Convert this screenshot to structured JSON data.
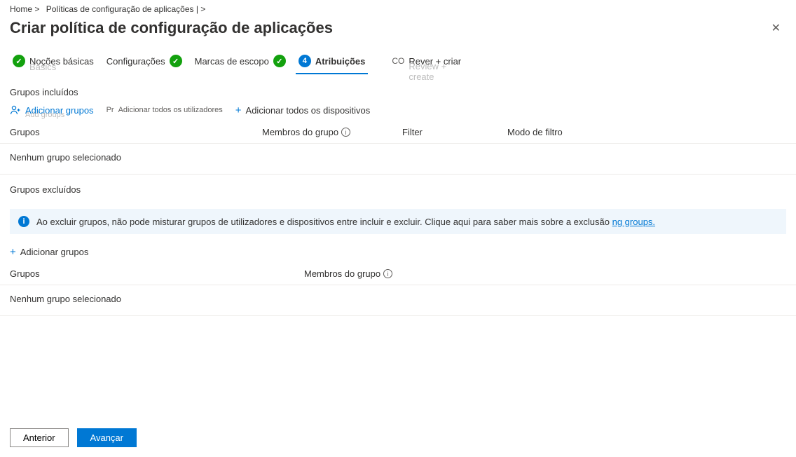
{
  "breadcrumb": {
    "home": "Home >",
    "parent": "Políticas de configuração de aplicações | >"
  },
  "page_title": "Criar política de configuração de aplicações",
  "wizard": {
    "step1_label": "Noções básicas",
    "step1_ghost": "Basics",
    "step2_label": "Configurações",
    "step3_label": "Marcas de escopo",
    "step4_num": "4",
    "step4_label": "Atribuições",
    "step5_prefix": "CO",
    "step5_label": "Rever + criar",
    "step5_ghost": "Review + create"
  },
  "included": {
    "heading": "Grupos incluídos",
    "add_groups": "Adicionar grupos",
    "add_groups_ghost": "Add groups",
    "add_users_prefix": "Pr",
    "add_all_users": "Adicionar todos os utilizadores",
    "add_all_devices": "Adicionar todos os dispositivos",
    "columns": {
      "groups": "Grupos",
      "members": "Membros do grupo",
      "filter": "Filter",
      "mode": "Modo de filtro"
    },
    "empty": "Nenhum grupo selecionado"
  },
  "excluded": {
    "heading": "Grupos excluídos",
    "banner_text": "Ao excluir grupos, não pode misturar grupos de utilizadores e dispositivos entre incluir e excluir. Clique aqui para saber mais sobre a exclusão",
    "banner_link": "ng groups.",
    "add_groups": "Adicionar grupos",
    "columns": {
      "groups": "Grupos",
      "members": "Membros do grupo"
    },
    "empty": "Nenhum grupo selecionado"
  },
  "footer": {
    "prev": "Anterior",
    "next": "Avançar"
  }
}
